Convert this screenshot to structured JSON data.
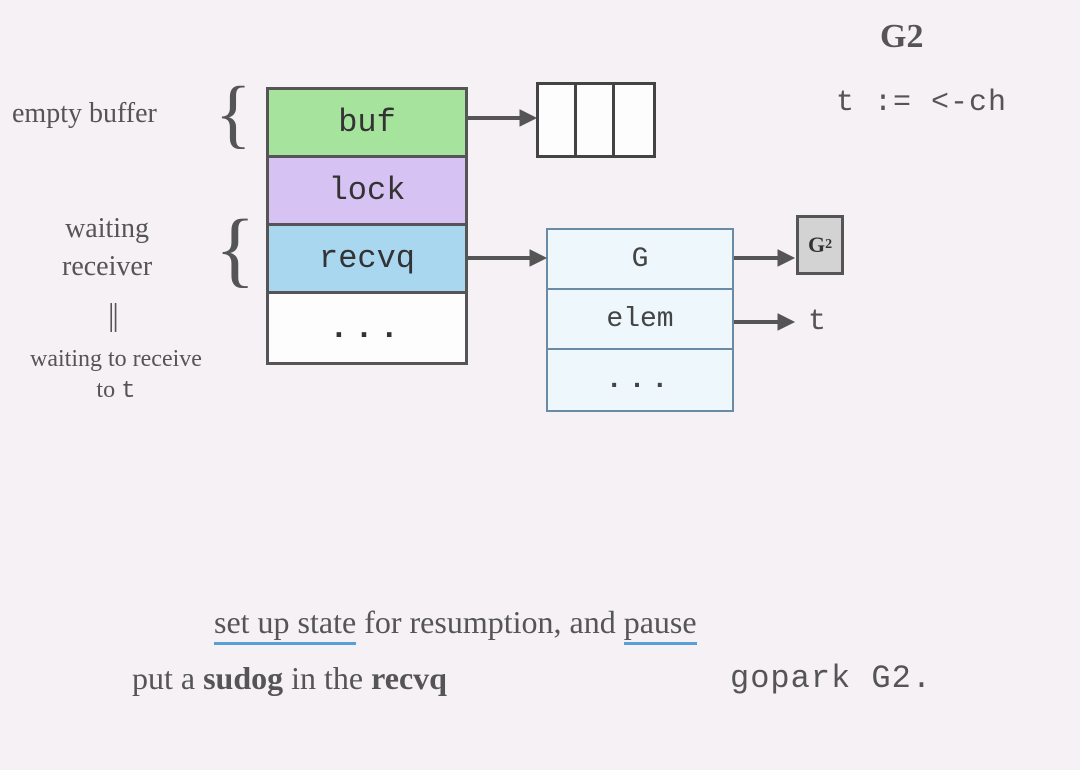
{
  "header": {
    "g2_title": "G2",
    "g2_code": "t := <-ch"
  },
  "annotations": {
    "empty_buffer": "empty buffer",
    "waiting_receiver_l1": "waiting",
    "waiting_receiver_l2": "receiver",
    "parallel": "||",
    "waiting_to_receive_l1": "waiting to receive",
    "waiting_to_receive_l2_pre": "to ",
    "waiting_to_receive_l2_t": "t"
  },
  "struct": {
    "buf": "buf",
    "lock": "lock",
    "recvq": "recvq",
    "dots": "..."
  },
  "sudog": {
    "G": "G",
    "elem": "elem",
    "dots": "..."
  },
  "targets": {
    "g2_box": "G",
    "g2_sub": "2",
    "t": "t"
  },
  "bottom": {
    "line1_u1": "set up state",
    "line1_mid": " for resumption, and ",
    "line1_u2": "pause",
    "line2_left_pre": "put a ",
    "line2_left_b1": "sudog",
    "line2_left_mid": " in the ",
    "line2_left_b2": "recvq",
    "line2_right": "gopark G2."
  }
}
